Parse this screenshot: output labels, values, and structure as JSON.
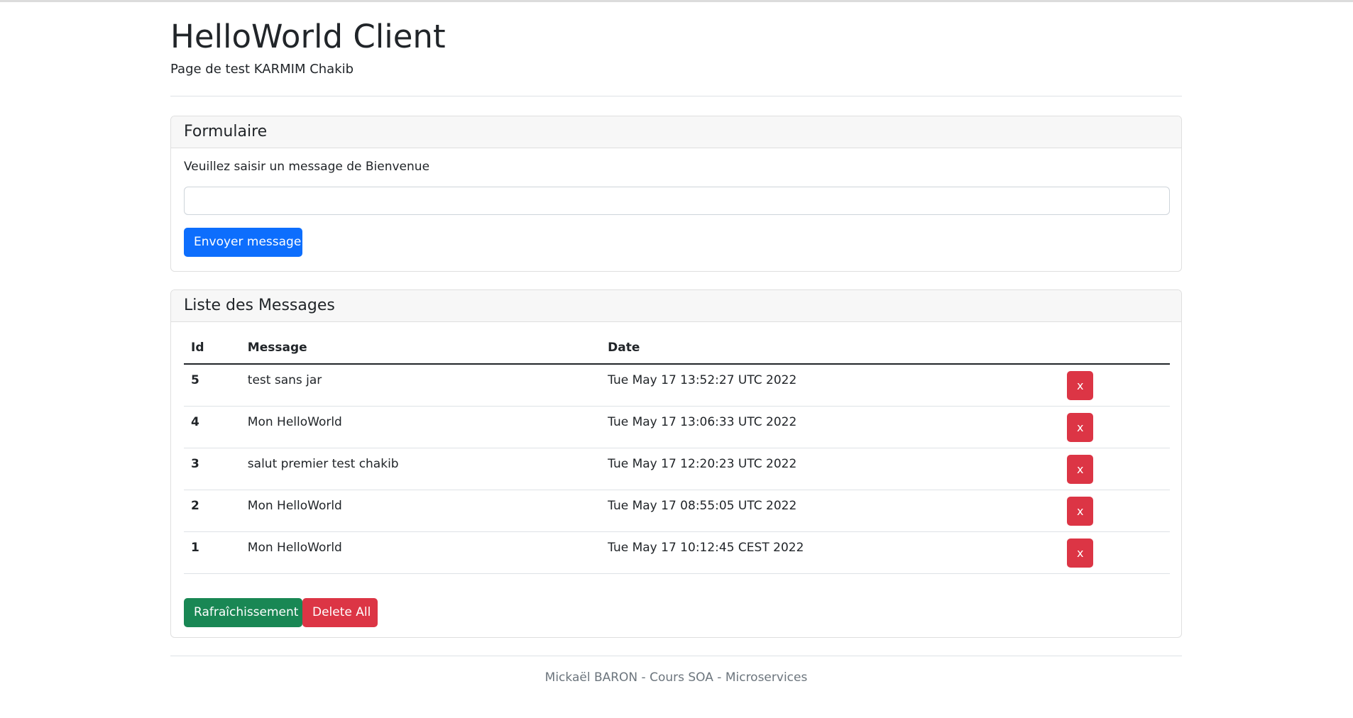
{
  "header": {
    "title": "HelloWorld Client",
    "subtitle": "Page de test KARMIM Chakib"
  },
  "form": {
    "heading": "Formulaire",
    "label": "Veuillez saisir un message de Bienvenue",
    "input_value": "",
    "input_placeholder": "",
    "submit_label": "Envoyer message"
  },
  "messages": {
    "heading": "Liste des Messages",
    "columns": {
      "id": "Id",
      "message": "Message",
      "date": "Date"
    },
    "rows": [
      {
        "id": "5",
        "message": "test sans jar",
        "date": "Tue May 17 13:52:27 UTC 2022",
        "delete_label": "x"
      },
      {
        "id": "4",
        "message": "Mon HelloWorld",
        "date": "Tue May 17 13:06:33 UTC 2022",
        "delete_label": "x"
      },
      {
        "id": "3",
        "message": "salut premier test chakib",
        "date": "Tue May 17 12:20:23 UTC 2022",
        "delete_label": "x"
      },
      {
        "id": "2",
        "message": "Mon HelloWorld",
        "date": "Tue May 17 08:55:05 UTC 2022",
        "delete_label": "x"
      },
      {
        "id": "1",
        "message": "Mon HelloWorld",
        "date": "Tue May 17 10:12:45 CEST 2022",
        "delete_label": "x"
      }
    ],
    "refresh_label": "Rafraîchissement",
    "delete_all_label": "Delete All"
  },
  "footer": {
    "text": "Mickaël BARON - Cours SOA - Microservices"
  },
  "colors": {
    "primary": "#0d6efd",
    "success": "#198754",
    "danger": "#dc3545",
    "muted": "#6c757d"
  }
}
